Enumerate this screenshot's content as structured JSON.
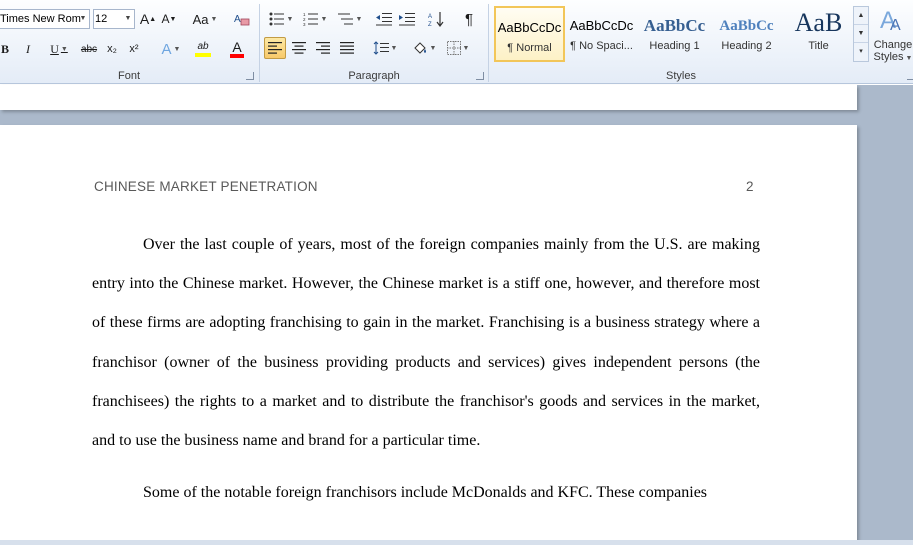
{
  "ribbon": {
    "font": {
      "label": "Font",
      "font_name": "Times New Rom",
      "font_size": "12",
      "grow_label": "A",
      "shrink_label": "A",
      "change_case_label": "Aa",
      "bold_label": "B",
      "italic_label": "I",
      "underline_label": "U",
      "strike_label": "abc",
      "subscript_label": "x₂",
      "superscript_label": "x²",
      "text_effects_label": "A",
      "highlight_label": "ab",
      "font_color_label": "A"
    },
    "paragraph": {
      "label": "Paragraph",
      "pilcrow": "¶"
    },
    "styles": {
      "label": "Styles",
      "items": [
        {
          "sample": "AaBbCcDc",
          "name": "¶ Normal"
        },
        {
          "sample": "AaBbCcDc",
          "name": "¶ No Spaci..."
        },
        {
          "sample": "AaBbCc",
          "name": "Heading 1"
        },
        {
          "sample": "AaBbCc",
          "name": "Heading 2"
        },
        {
          "sample": "AaB",
          "name": "Title"
        }
      ],
      "change_styles_line1": "Change",
      "change_styles_line2": "Styles"
    },
    "colors": {
      "highlight": "#ffff00",
      "font_color": "#ff0000",
      "heading": "#365f91",
      "title": "#17365d"
    }
  },
  "document": {
    "header": "CHINESE MARKET PENETRATION",
    "page_number": "2",
    "paragraphs": [
      "Over the last couple of years, most of the foreign companies mainly from the U.S. are making entry into the Chinese market. However, the Chinese market is a stiff one, however, and therefore most of these firms are adopting franchising to gain in the market. Franchising is a business strategy where a franchisor (owner of the business providing products and services) gives independent persons (the franchisees) the rights to a market and to distribute the franchisor's goods and services in the market, and to use the business name and brand for a particular time.",
      "Some of the notable foreign franchisors include McDonalds and KFC. These companies"
    ]
  }
}
